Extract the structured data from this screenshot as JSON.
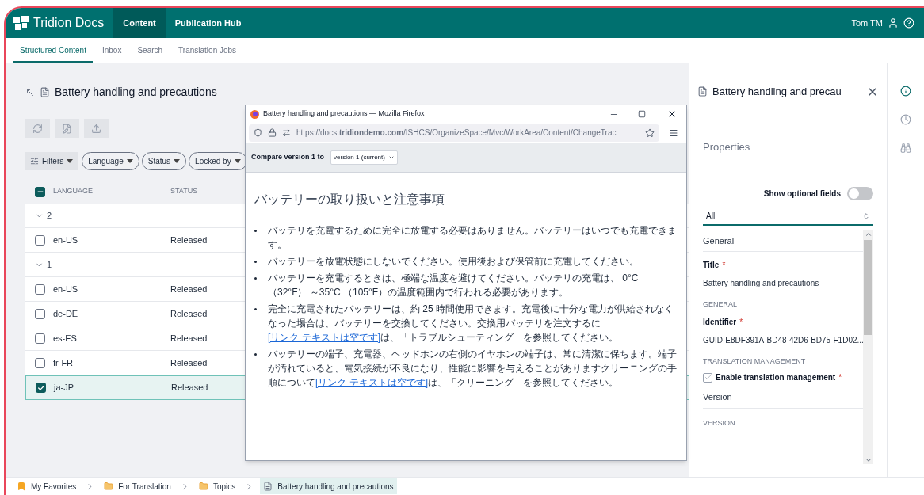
{
  "header": {
    "logo": "Tridion Docs",
    "nav": [
      {
        "label": "Content",
        "selected": true
      },
      {
        "label": "Publication Hub",
        "selected": false
      }
    ],
    "user": "Tom TM"
  },
  "subnav": [
    {
      "label": "Structured Content",
      "selected": true
    },
    {
      "label": "Inbox",
      "selected": false
    },
    {
      "label": "Search",
      "selected": false
    },
    {
      "label": "Translation Jobs",
      "selected": false
    }
  ],
  "content": {
    "title": "Battery handling and precautions",
    "filters": [
      {
        "label": "Filters",
        "kind": "menu"
      },
      {
        "label": "Language",
        "kind": "chip"
      },
      {
        "label": "Status",
        "kind": "chip"
      },
      {
        "label": "Locked by",
        "kind": "chip"
      }
    ],
    "table": {
      "indeterminate": true,
      "columns": [
        "LANGUAGE",
        "STATUS"
      ],
      "rows": [
        {
          "kind": "group",
          "label": "2",
          "expanded": true
        },
        {
          "kind": "row",
          "language": "en-US",
          "status": "Released",
          "selected": false
        },
        {
          "kind": "group",
          "label": "1",
          "expanded": true
        },
        {
          "kind": "row",
          "language": "en-US",
          "status": "Released",
          "selected": false
        },
        {
          "kind": "row",
          "language": "de-DE",
          "status": "Released",
          "selected": false
        },
        {
          "kind": "row",
          "language": "es-ES",
          "status": "Released",
          "selected": false
        },
        {
          "kind": "row",
          "language": "fr-FR",
          "status": "Released",
          "selected": false
        },
        {
          "kind": "row",
          "language": "ja-JP",
          "status": "Released",
          "selected": true
        }
      ]
    }
  },
  "browser": {
    "title": "Battery handling and precautions — Mozilla Firefox",
    "url": "https://docs.**tridiondemo.com**/ISHCS/OrganizeSpace/Mvc/WorkArea/Content/ChangeTrac",
    "compare_label": "Compare version 1 to",
    "compare_value": "version 1 (current)",
    "heading": "バッテリーの取り扱いと注意事項",
    "bullets": [
      {
        "text": "バッテリを充電するために完全に放電する必要はありません。バッテリーはいつでも充電できます。"
      },
      {
        "text": "バッテリーを放電状態にしないでください。使用後および保管前に充電してください。"
      },
      {
        "text": "バッテリーを充電するときは、極端な温度を避けてください。バッテリの充電は、 0°C （32°F） ～35°C （105°F）の温度範囲内で行われる必要があります。"
      },
      {
        "text": "完全に充電されたバッテリーは、約 25 時間使用できます。充電後に十分な電力が供給されなくなった場合は、バッテリーを交換してください。交換用バッテリを注文するに",
        "link": "[リンク テキストは空です]",
        "after": "は、「トラブルシューティング」を参照してください。"
      },
      {
        "text": "バッテリーの端子、充電器、ヘッドホンの右側のイヤホンの端子は、常に清潔に保ちます。端子が汚れていると、電気接続が不良になり、性能に影響を与えることがありますクリーニングの手順について",
        "link": "[リンク テキストは空です]",
        "after": "は、「クリーニング」を参照してください。"
      }
    ]
  },
  "panel": {
    "title": "Battery handling and precau",
    "heading": "Properties",
    "toggle": {
      "label": "Show optional fields",
      "on": false
    },
    "select": "All",
    "items": [
      {
        "kind": "section",
        "label": "General"
      },
      {
        "kind": "field",
        "label": "Title",
        "required_mark": "*",
        "value": "Battery handling and precautions"
      },
      {
        "kind": "group",
        "label": "GENERAL"
      },
      {
        "kind": "field",
        "label": "Identifier",
        "required_mark": "*",
        "value": "GUID-E8DF391A-BD48-42D6-BD75-F1D02..."
      },
      {
        "kind": "group",
        "label": "TRANSLATION MANAGEMENT"
      },
      {
        "kind": "checkbox",
        "label": "Enable translation management",
        "required_mark": "*",
        "checked": true
      },
      {
        "kind": "section",
        "label": "Version"
      },
      {
        "kind": "group",
        "label": "VERSION"
      }
    ]
  },
  "rail": [
    {
      "kind": "info",
      "selected": true
    },
    {
      "kind": "history",
      "selected": false
    },
    {
      "kind": "binoculars",
      "selected": false
    }
  ],
  "breadcrumb": [
    {
      "kind": "favorites",
      "label": "My Favorites",
      "selected": false
    },
    {
      "kind": "folder",
      "label": "For Translation",
      "selected": false
    },
    {
      "kind": "folder",
      "label": "Topics",
      "selected": false
    },
    {
      "kind": "document",
      "label": "Battery handling and precautions",
      "selected": true
    }
  ]
}
